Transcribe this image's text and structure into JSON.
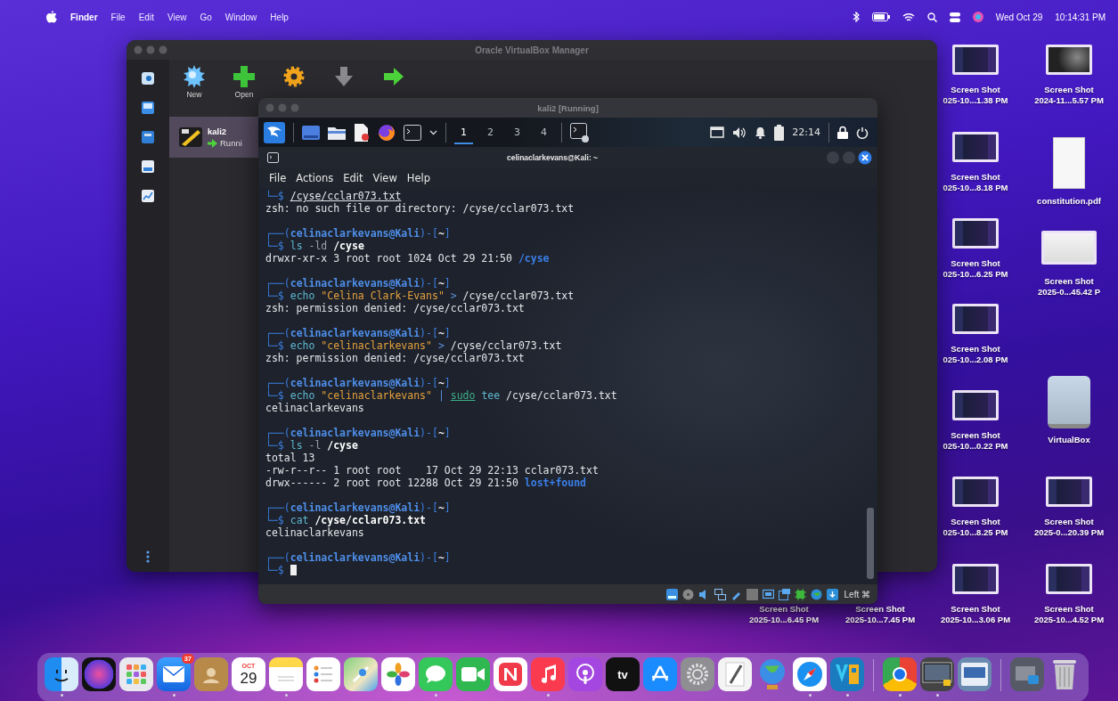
{
  "menubar": {
    "app": "Finder",
    "menus": [
      "File",
      "Edit",
      "View",
      "Go",
      "Window",
      "Help"
    ],
    "date": "Wed Oct 29",
    "time": "10:14:31 PM"
  },
  "vbox_manager": {
    "title": "Oracle VirtualBox Manager",
    "tools": [
      {
        "kind": "new",
        "label": "New"
      },
      {
        "kind": "add",
        "label": "Open"
      },
      {
        "kind": "settings"
      },
      {
        "kind": "discard"
      },
      {
        "kind": "start"
      }
    ],
    "vms": [
      {
        "name": "kali2",
        "state": "Runni",
        "selected": true
      }
    ]
  },
  "vm_window": {
    "title": "kali2 [Running]",
    "panel": {
      "workspaces": [
        {
          "label": "1",
          "selected": true
        },
        {
          "label": "2",
          "selected": false
        },
        {
          "label": "3",
          "selected": false
        },
        {
          "label": "4",
          "selected": false
        }
      ],
      "clock": "22:14"
    },
    "status_bar": {
      "host_key": "Left ⌘"
    }
  },
  "terminal": {
    "title": "celinaclarkevans@Kali: ~",
    "menus": [
      "File",
      "Actions",
      "Edit",
      "View",
      "Help"
    ],
    "blocks": [
      {
        "command": [
          {
            "kind": "frame",
            "text": "└─$ "
          },
          {
            "kind": "underlined",
            "text": "/cyse/cclar073.txt"
          }
        ],
        "output": [
          [
            {
              "kind": "text",
              "text": "zsh: no such file or directory: /cyse/cclar073.txt"
            }
          ]
        ]
      },
      {
        "prompt": [
          {
            "kind": "frame",
            "text": "┌──("
          },
          {
            "kind": "user",
            "text": "celinaclarkevans@Kali"
          },
          {
            "kind": "frame",
            "text": ")-["
          },
          {
            "kind": "dir",
            "text": "~"
          },
          {
            "kind": "frame",
            "text": "]"
          }
        ],
        "command": [
          {
            "kind": "frame",
            "text": "└─$ "
          },
          {
            "kind": "command",
            "text": "ls"
          },
          {
            "kind": "option",
            "text": " -ld"
          },
          {
            "kind": "path",
            "text": " /cyse"
          }
        ],
        "output": [
          [
            {
              "kind": "text",
              "text": "drwxr-xr-x 3 root root 1024 Oct 29 21:50 "
            },
            {
              "kind": "directory",
              "text": "/cyse"
            }
          ]
        ]
      },
      {
        "prompt": [
          {
            "kind": "frame",
            "text": "┌──("
          },
          {
            "kind": "user",
            "text": "celinaclarkevans@Kali"
          },
          {
            "kind": "frame",
            "text": ")-["
          },
          {
            "kind": "dir",
            "text": "~"
          },
          {
            "kind": "frame",
            "text": "]"
          }
        ],
        "command": [
          {
            "kind": "frame",
            "text": "└─$ "
          },
          {
            "kind": "command",
            "text": "echo"
          },
          {
            "kind": "string",
            "text": " \"Celina Clark-Evans\""
          },
          {
            "kind": "operator",
            "text": " >"
          },
          {
            "kind": "text",
            "text": " /cyse/cclar073.txt"
          }
        ],
        "output": [
          [
            {
              "kind": "text",
              "text": "zsh: permission denied: /cyse/cclar073.txt"
            }
          ]
        ]
      },
      {
        "prompt": [
          {
            "kind": "frame",
            "text": "┌──("
          },
          {
            "kind": "user",
            "text": "celinaclarkevans@Kali"
          },
          {
            "kind": "frame",
            "text": ")-["
          },
          {
            "kind": "dir",
            "text": "~"
          },
          {
            "kind": "frame",
            "text": "]"
          }
        ],
        "command": [
          {
            "kind": "frame",
            "text": "└─$ "
          },
          {
            "kind": "command",
            "text": "echo"
          },
          {
            "kind": "string",
            "text": " \"celinaclarkevans\""
          },
          {
            "kind": "operator",
            "text": " >"
          },
          {
            "kind": "text",
            "text": " /cyse/cclar073.txt"
          }
        ],
        "output": [
          [
            {
              "kind": "text",
              "text": "zsh: permission denied: /cyse/cclar073.txt"
            }
          ]
        ]
      },
      {
        "prompt": [
          {
            "kind": "frame",
            "text": "┌──("
          },
          {
            "kind": "user",
            "text": "celinaclarkevans@Kali"
          },
          {
            "kind": "frame",
            "text": ")-["
          },
          {
            "kind": "dir",
            "text": "~"
          },
          {
            "kind": "frame",
            "text": "]"
          }
        ],
        "command": [
          {
            "kind": "frame",
            "text": "└─$ "
          },
          {
            "kind": "command",
            "text": "echo"
          },
          {
            "kind": "string",
            "text": " \"celinaclarkevans\""
          },
          {
            "kind": "operator",
            "text": " | "
          },
          {
            "kind": "sudo",
            "text": "sudo"
          },
          {
            "kind": "command",
            "text": " tee"
          },
          {
            "kind": "text",
            "text": " /cyse/cclar073.txt"
          }
        ],
        "output": [
          [
            {
              "kind": "text",
              "text": "celinaclarkevans"
            }
          ]
        ]
      },
      {
        "prompt": [
          {
            "kind": "frame",
            "text": "┌──("
          },
          {
            "kind": "user",
            "text": "celinaclarkevans@Kali"
          },
          {
            "kind": "frame",
            "text": ")-["
          },
          {
            "kind": "dir",
            "text": "~"
          },
          {
            "kind": "frame",
            "text": "]"
          }
        ],
        "command": [
          {
            "kind": "frame",
            "text": "└─$ "
          },
          {
            "kind": "command",
            "text": "ls"
          },
          {
            "kind": "option",
            "text": " -l"
          },
          {
            "kind": "path",
            "text": " /cyse"
          }
        ],
        "output": [
          [
            {
              "kind": "text",
              "text": "total 13"
            }
          ],
          [
            {
              "kind": "text",
              "text": "-rw-r--r-- 1 root root    17 Oct 29 22:13 cclar073.txt"
            }
          ],
          [
            {
              "kind": "text",
              "text": "drwx------ 2 root root 12288 Oct 29 21:50 "
            },
            {
              "kind": "directory",
              "text": "lost+found"
            }
          ]
        ]
      },
      {
        "prompt": [
          {
            "kind": "frame",
            "text": "┌──("
          },
          {
            "kind": "user",
            "text": "celinaclarkevans@Kali"
          },
          {
            "kind": "frame",
            "text": ")-["
          },
          {
            "kind": "dir",
            "text": "~"
          },
          {
            "kind": "frame",
            "text": "]"
          }
        ],
        "command": [
          {
            "kind": "frame",
            "text": "└─$ "
          },
          {
            "kind": "command",
            "text": "cat"
          },
          {
            "kind": "path",
            "text": " /cyse/cclar073.txt"
          }
        ],
        "output": [
          [
            {
              "kind": "text",
              "text": "celinaclarkevans"
            }
          ]
        ]
      },
      {
        "prompt": [
          {
            "kind": "frame",
            "text": "┌──("
          },
          {
            "kind": "user",
            "text": "celinaclarkevans@Kali"
          },
          {
            "kind": "frame",
            "text": ")-["
          },
          {
            "kind": "dir",
            "text": "~"
          },
          {
            "kind": "frame",
            "text": "]"
          }
        ],
        "command": [
          {
            "kind": "frame",
            "text": "└─$ "
          },
          {
            "kind": "cursor"
          }
        ]
      }
    ]
  },
  "desktop_icons": [
    {
      "kind": "screenshot",
      "lines": [
        "Screen Shot",
        "025-10...1.38 PM"
      ]
    },
    {
      "kind": "photo",
      "lines": [
        "Screen Shot",
        "2024-11...5.57 PM"
      ]
    },
    {
      "kind": "screenshot",
      "lines": [
        "Screen Shot",
        "025-10...8.18 PM"
      ]
    },
    {
      "kind": "pdf",
      "lines": [
        "constitution.pdf"
      ]
    },
    {
      "kind": "screenshot",
      "lines": [
        "Screen Shot",
        "025-10...6.25 PM"
      ]
    },
    {
      "kind": "image",
      "lines": [
        "Screen Shot",
        "2025-0...45.42 P"
      ]
    },
    {
      "kind": "screenshot",
      "lines": [
        "Screen Shot",
        "025-10...2.08 PM"
      ]
    },
    {
      "kind": "screenshot",
      "lines": [
        "Screen Shot",
        "025-10...0.22 PM"
      ]
    },
    {
      "kind": "disk",
      "lines": [
        "VirtualBox"
      ]
    },
    {
      "kind": "screenshot",
      "lines": [
        "Screen Shot",
        "025-10...8.25 PM"
      ]
    },
    {
      "kind": "screenshot",
      "lines": [
        "Screen Shot",
        "2025-0...20.39 PM"
      ]
    },
    {
      "kind": "covered",
      "lines": [
        "Screen Shot",
        "2025-10...6.45 PM"
      ]
    },
    {
      "kind": "covered",
      "lines": [
        "Screen Shot",
        "2025-10...7.45 PM"
      ]
    },
    {
      "kind": "screenshot",
      "lines": [
        "Screen Shot",
        "2025-10...3.06 PM"
      ]
    },
    {
      "kind": "screenshot",
      "lines": [
        "Screen Shot",
        "2025-10...4.52 PM"
      ]
    }
  ],
  "dock": {
    "apps": [
      {
        "kind": "finder",
        "running": true
      },
      {
        "kind": "orb",
        "running": false
      },
      {
        "kind": "grid",
        "running": false
      },
      {
        "kind": "mail",
        "running": true,
        "badge": "37"
      },
      {
        "kind": "contacts",
        "running": false
      },
      {
        "kind": "calendar",
        "running": false,
        "month": "OCT",
        "day": "29"
      },
      {
        "kind": "notes",
        "running": true
      },
      {
        "kind": "reminders",
        "running": false
      },
      {
        "kind": "maps",
        "running": false
      },
      {
        "kind": "photos",
        "running": false
      },
      {
        "kind": "messages",
        "running": true
      },
      {
        "kind": "facetime",
        "running": false
      },
      {
        "kind": "news",
        "running": false
      },
      {
        "kind": "music",
        "running": true
      },
      {
        "kind": "podcasts",
        "running": false
      },
      {
        "kind": "tv",
        "running": false,
        "label": "tv"
      },
      {
        "kind": "appstore",
        "running": false
      },
      {
        "kind": "settings",
        "running": false
      },
      {
        "kind": "textedit",
        "running": false
      },
      {
        "kind": "globe",
        "running": false
      },
      {
        "kind": "safari",
        "running": true
      },
      {
        "kind": "tile",
        "running": true
      }
    ],
    "recents": [
      {
        "kind": "chrome",
        "running": true
      },
      {
        "kind": "monitor",
        "running": true
      },
      {
        "kind": "window",
        "running": false
      }
    ],
    "others": [
      {
        "kind": "folder"
      },
      {
        "kind": "trash"
      }
    ]
  }
}
